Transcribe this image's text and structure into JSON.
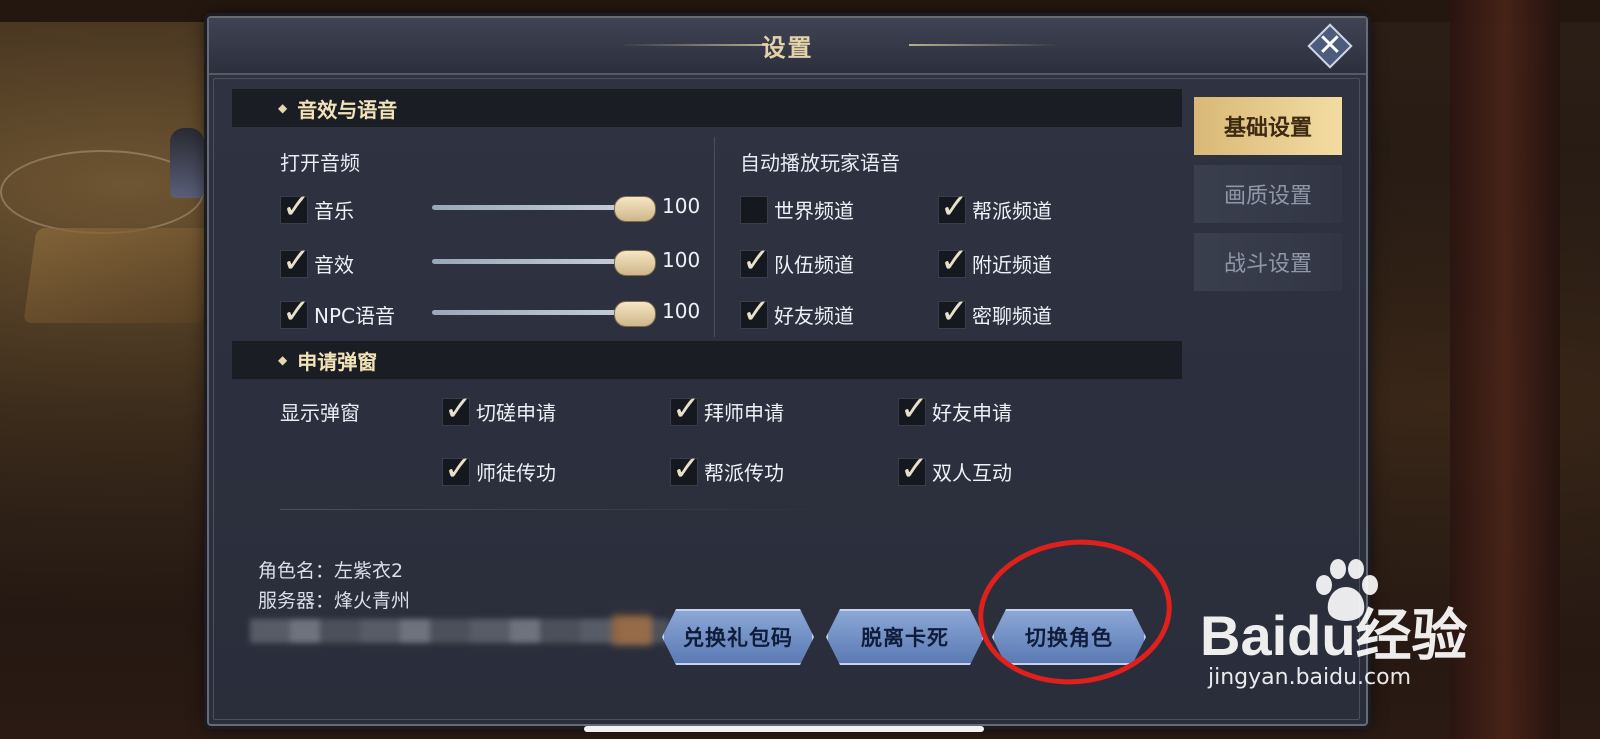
{
  "dialog": {
    "title": "设置",
    "close_icon": "close-x-icon"
  },
  "sections": {
    "audio": {
      "header": "音效与语音",
      "open_audio_label": "打开音频",
      "sliders": [
        {
          "label": "音乐",
          "checked": true,
          "value": 100
        },
        {
          "label": "音效",
          "checked": true,
          "value": 100
        },
        {
          "label": "NPC语音",
          "checked": true,
          "value": 100
        }
      ],
      "auto_play_label": "自动播放玩家语音",
      "channels": [
        {
          "label": "世界频道",
          "checked": false
        },
        {
          "label": "帮派频道",
          "checked": true
        },
        {
          "label": "队伍频道",
          "checked": true
        },
        {
          "label": "附近频道",
          "checked": true
        },
        {
          "label": "好友频道",
          "checked": true
        },
        {
          "label": "密聊频道",
          "checked": true
        }
      ]
    },
    "popups": {
      "header": "申请弹窗",
      "show_label": "显示弹窗",
      "options": [
        {
          "label": "切磋申请",
          "checked": true
        },
        {
          "label": "拜师申请",
          "checked": true
        },
        {
          "label": "好友申请",
          "checked": true
        },
        {
          "label": "师徒传功",
          "checked": true
        },
        {
          "label": "帮派传功",
          "checked": true
        },
        {
          "label": "双人互动",
          "checked": true
        }
      ]
    }
  },
  "info": {
    "character": "角色名：左紫衣2",
    "server": "服务器：烽火青州"
  },
  "buttons": {
    "redeem": "兑换礼包码",
    "unstuck": "脱离卡死",
    "switch_role": "切换角色"
  },
  "tabs": [
    {
      "label": "基础设置",
      "active": true
    },
    {
      "label": "画质设置",
      "active": false
    },
    {
      "label": "战斗设置",
      "active": false
    }
  ],
  "watermark": {
    "brand": "Baidu经验",
    "url": "jingyan.baidu.com"
  },
  "colors": {
    "accent_gold": "#e4d2a8",
    "button_blue": "#6f8ec6",
    "annotation_red": "#e0201c"
  }
}
